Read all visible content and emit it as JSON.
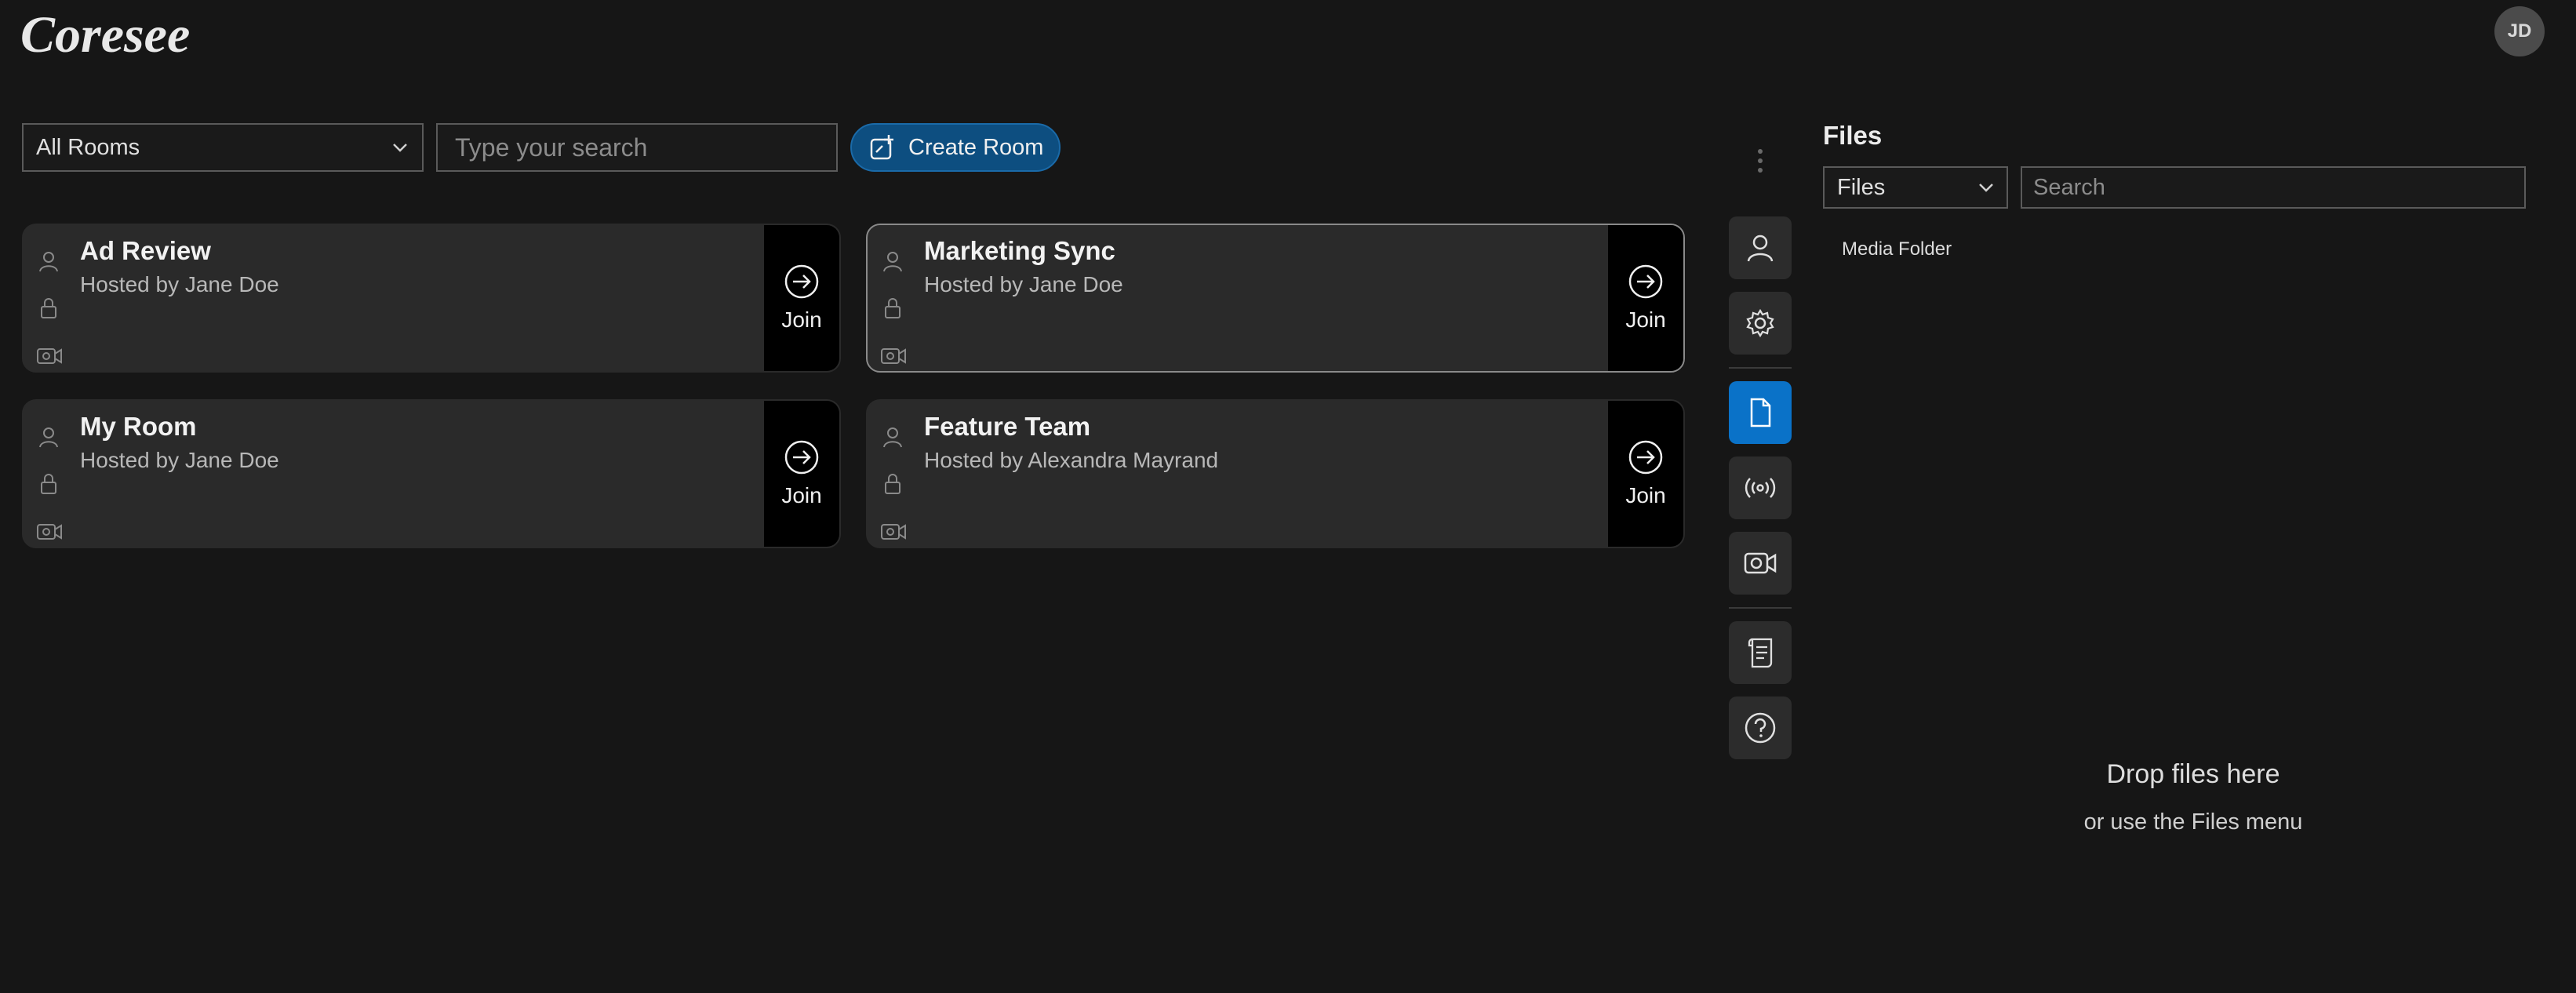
{
  "app": {
    "logo_text": "Coresee"
  },
  "user": {
    "initials": "JD"
  },
  "toolbar": {
    "rooms_filter": "All Rooms",
    "search_placeholder": "Type your search",
    "create_room_label": "Create Room"
  },
  "rooms": [
    {
      "name": "Ad Review",
      "host": "Hosted by Jane Doe",
      "join_label": "Join"
    },
    {
      "name": "Marketing Sync",
      "host": "Hosted by Jane Doe",
      "join_label": "Join"
    },
    {
      "name": "My Room",
      "host": "Hosted by Jane Doe",
      "join_label": "Join"
    },
    {
      "name": "Feature Team",
      "host": "Hosted by Alexandra Mayrand",
      "join_label": "Join"
    }
  ],
  "rail": {
    "items": [
      "user-icon",
      "gear-icon",
      "file-icon",
      "broadcast-icon",
      "camera-icon",
      "scroll-icon",
      "help-icon"
    ],
    "active": "file-icon",
    "accent": "#0a72c8"
  },
  "files_panel": {
    "title": "Files",
    "filter": "Files",
    "search_placeholder": "Search",
    "items": [
      "Media Folder"
    ],
    "drop_title": "Drop files here",
    "drop_subtitle": "or use the Files menu"
  }
}
